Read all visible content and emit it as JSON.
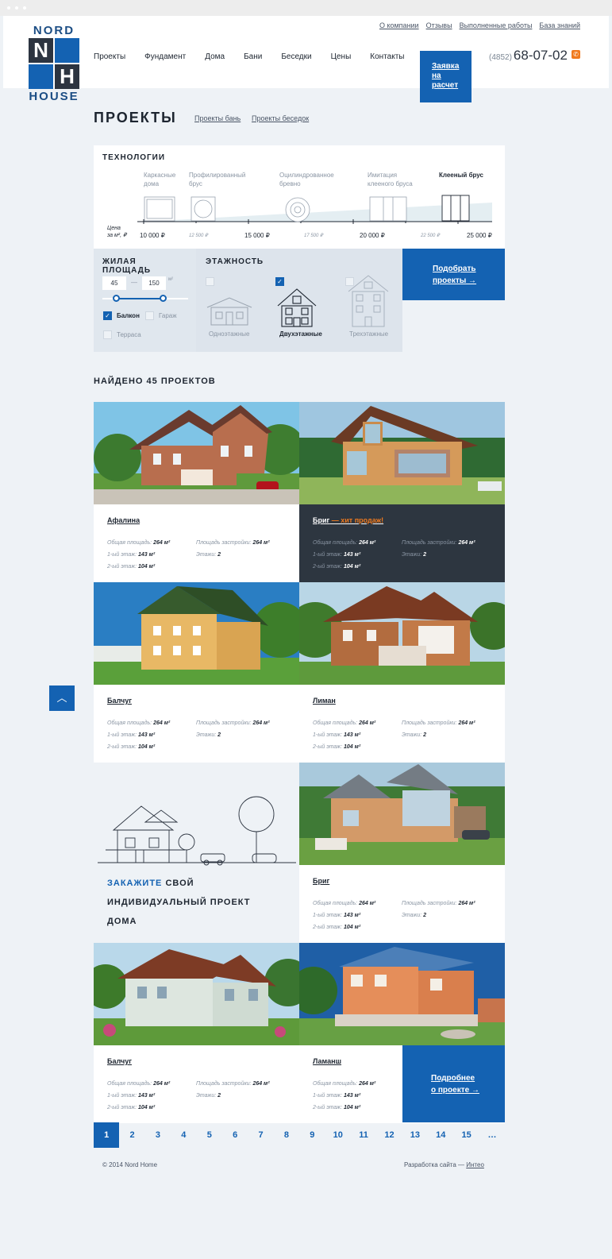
{
  "logo": {
    "top": "NORD",
    "n": "N",
    "h": "H",
    "bottom": "HOUSE"
  },
  "top_nav": [
    "О компании",
    "Отзывы",
    "Выполненные работы",
    "База знаний"
  ],
  "main_nav": [
    "Проекты",
    "Фундамент",
    "Дома",
    "Бани",
    "Беседки",
    "Цены",
    "Контакты"
  ],
  "cta": {
    "line1": "Заявка",
    "line2": "на",
    "line3": "расчет"
  },
  "phone": {
    "code": "(4852)",
    "number": "68-07-02"
  },
  "page": {
    "title": "ПРОЕКТЫ",
    "link1": "Проекты бань",
    "link2": "Проекты беседок"
  },
  "tech": {
    "title": "ТЕХНОЛОГИИ",
    "axis1": "Цена",
    "axis2": "за м², ₽",
    "types": [
      {
        "l1": "Каркасные",
        "l2": "дома"
      },
      {
        "l1": "Профилированный",
        "l2": "брус"
      },
      {
        "l1": "Оцилиндрованное",
        "l2": "бревно"
      },
      {
        "l1": "Имитация",
        "l2": "клееного бруса"
      },
      {
        "l1": "Клееный брус",
        "l2": ""
      }
    ],
    "prices": [
      "10 000 ₽",
      "12 500 ₽",
      "15 000 ₽",
      "17 500 ₽",
      "20 000 ₽",
      "22 500 ₽",
      "25 000 ₽"
    ]
  },
  "filters": {
    "area_title": "ЖИЛАЯ ПЛОЩАДЬ",
    "area_from": "45",
    "area_to": "150",
    "unit": "м²",
    "dash": "—",
    "balcony": "Балкон",
    "garage": "Гараж",
    "terrace": "Терраса",
    "floors_title": "ЭТАЖНОСТЬ",
    "floor1": "Одноэтажные",
    "floor2": "Двухэтажные",
    "floor3": "Трехэтажные",
    "submit1": "Подобрать",
    "submit2": "проекты →"
  },
  "found": "НАЙДЕНО 45 ПРОЕКТОВ",
  "labels": {
    "total": "Общая площадь:",
    "built": "Площадь застройки:",
    "floor1": "1-ый этаж:",
    "floor2": "2-ый этаж:",
    "floors": "Этажи:"
  },
  "projects": [
    {
      "name": "Афалина",
      "hit": "",
      "total": "264 м²",
      "built": "264 м²",
      "f1": "143 м²",
      "f2": "104 м²",
      "floors": "2"
    },
    {
      "name": "Бриг",
      "hit": " — хит продаж!",
      "total": "264 м²",
      "built": "264 м²",
      "f1": "143 м²",
      "f2": "104 м²",
      "floors": "2"
    },
    {
      "name": "Балчуг",
      "hit": "",
      "total": "264 м²",
      "built": "264 м²",
      "f1": "143 м²",
      "f2": "104 м²",
      "floors": "2"
    },
    {
      "name": "Лиман",
      "hit": "",
      "total": "264 м²",
      "built": "264 м²",
      "f1": "143 м²",
      "f2": "104 м²",
      "floors": "2"
    },
    {
      "name": "Бриг",
      "hit": "",
      "total": "264 м²",
      "built": "264 м²",
      "f1": "143 м²",
      "f2": "104 м²",
      "floors": "2"
    },
    {
      "name": "Балчуг",
      "hit": "",
      "total": "264 м²",
      "built": "264 м²",
      "f1": "143 м²",
      "f2": "104 м²",
      "floors": "2"
    },
    {
      "name": "Ламанш",
      "hit": "",
      "total": "264 м²",
      "built": "",
      "f1": "143 м²",
      "f2": "104 м²",
      "floors": ""
    }
  ],
  "custom": {
    "accent": "ЗАКАЖИТЕ",
    "rest1": " СВОЙ",
    "line2": "ИНДИВИДУАЛЬНЫЙ ПРОЕКТ",
    "line3": "ДОМА"
  },
  "more": {
    "line1": "Подробнее",
    "line2": "о проекте →"
  },
  "up_arrow": "︿",
  "pages": [
    "1",
    "2",
    "3",
    "4",
    "5",
    "6",
    "7",
    "8",
    "9",
    "10",
    "11",
    "12",
    "13",
    "14",
    "15",
    "…"
  ],
  "footer": {
    "copy": "© 2014 Nord Home",
    "dev": "Разработка сайта — ",
    "dev_link": "Интео"
  },
  "colors": {
    "accent": "#1462b2",
    "dark": "#2d3640",
    "hit": "#f07a1e",
    "bg": "#eef2f6"
  }
}
